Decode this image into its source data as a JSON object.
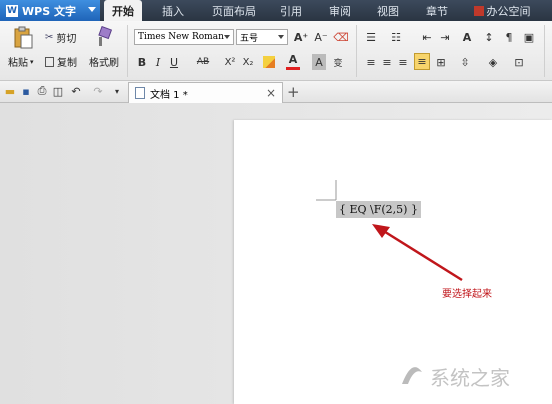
{
  "app": {
    "name": "WPS 文字",
    "logo_letter": "W"
  },
  "menu": {
    "tabs": [
      {
        "label": "开始",
        "active": true
      },
      {
        "label": "插入"
      },
      {
        "label": "页面布局"
      },
      {
        "label": "引用"
      },
      {
        "label": "审阅"
      },
      {
        "label": "视图"
      },
      {
        "label": "章节"
      },
      {
        "label": "办公空间"
      }
    ]
  },
  "ribbon": {
    "paste_label": "粘贴",
    "cut_label": "剪切",
    "copy_label": "复制",
    "format_painter_label": "格式刷",
    "font_name": "Times New Roman",
    "font_size": "五号",
    "bold": "B",
    "italic": "I",
    "underline": "U",
    "strike": "AB",
    "superscript": "X²",
    "subscript": "X₂",
    "grow_font": "A⁺",
    "shrink_font": "A⁻",
    "font_color": "A",
    "char_shade": "A",
    "phonetic": "变"
  },
  "tabs_row": {
    "doc_title": "文档 1 *"
  },
  "document": {
    "field_code": "{ EQ \\F(2,5) }",
    "note": "要选择起来",
    "note_color": "#c0161b"
  },
  "watermark": "系统之家"
}
